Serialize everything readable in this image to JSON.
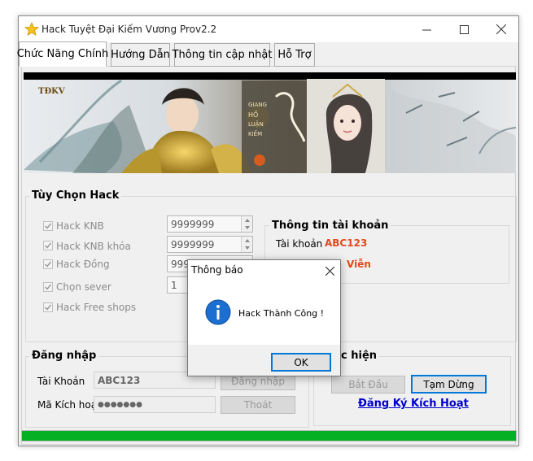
{
  "window": {
    "title": "Hack Tuyệt Đại Kiếm Vương  Prov2.2"
  },
  "tabs": [
    {
      "label": "Chức Năng Chính",
      "active": true
    },
    {
      "label": "Hướng Dẫn",
      "active": false
    },
    {
      "label": "Thông tin cập nhật",
      "active": false
    },
    {
      "label": "Hỗ Trợ",
      "active": false
    }
  ],
  "hack_options": {
    "title": "Tùy Chọn Hack",
    "items": [
      {
        "label": "Hack KNB",
        "checked": true,
        "value": "9999999"
      },
      {
        "label": "Hack KNB khóa",
        "checked": true,
        "value": "9999999"
      },
      {
        "label": "Hack Đồng",
        "checked": true,
        "value": "9999999"
      },
      {
        "label": "Chọn sever",
        "checked": true,
        "value": "1"
      },
      {
        "label": "Hack Free shops",
        "checked": true
      }
    ]
  },
  "account_info": {
    "title": "Thông tin tài khoản",
    "account_label": "Tài khoản",
    "account_value": "ABC123",
    "partial_value": "Viễn"
  },
  "login": {
    "title": "Đăng nhập",
    "username_label": "Tài Khoản",
    "username_value": "ABC123",
    "password_label": "Mã Kích hoạt",
    "password_value": "●●●●●●●",
    "login_button": "Đăng nhập",
    "exit_button": "Thoát"
  },
  "execute": {
    "title_partial": "c hiện",
    "start_button": "Bắt Đầu",
    "stop_button": "Tạm Dừng",
    "register_link": "Đăng Ký Kích Hoạt"
  },
  "progress": {
    "value": 1.0
  },
  "dialog": {
    "title": "Thông báo",
    "message": "Hack Thành Công !",
    "ok_button": "OK"
  },
  "colors": {
    "accent": "#0078d7",
    "account_value": "#e0491b",
    "link": "#0000cc",
    "progress": "#06b025"
  }
}
